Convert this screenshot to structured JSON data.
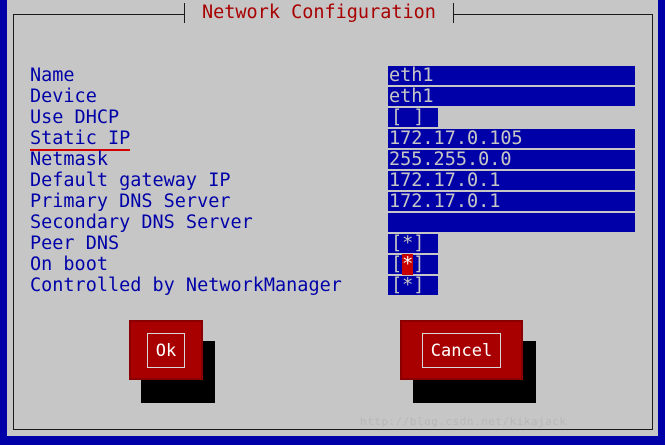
{
  "dialog": {
    "title": "Network Configuration"
  },
  "fields": [
    {
      "label": "Name",
      "value": "eth1"
    },
    {
      "label": "Device",
      "value": "eth1"
    },
    {
      "label": "Use DHCP",
      "value": "[ ]"
    },
    {
      "label": "Static IP",
      "value": "172.17.0.105"
    },
    {
      "label": "Netmask",
      "value": "255.255.0.0"
    },
    {
      "label": "Default gateway IP",
      "value": "172.17.0.1"
    },
    {
      "label": "Primary DNS Server",
      "value": "172.17.0.1"
    },
    {
      "label": "Secondary DNS Server",
      "value": ""
    }
  ],
  "checkboxes": [
    {
      "label": "Peer DNS",
      "open": "[",
      "mark": "*",
      "close": "]",
      "checked": true
    },
    {
      "label": "On boot",
      "open": "[",
      "mark": "*",
      "close": "]",
      "checked": true
    },
    {
      "label": "Controlled by NetworkManager",
      "open": "[",
      "mark": "*",
      "close": "]",
      "checked": true
    }
  ],
  "buttons": {
    "ok": "Ok",
    "cancel": "Cancel"
  },
  "watermark": "http://blog.csdn.net/kikajack",
  "colors": {
    "screen": "#0000a8",
    "dialog": "#c6c6c6",
    "label": "#0000a8",
    "title": "#a80000",
    "button": "#a80000",
    "focus_underline": "#d40000"
  }
}
